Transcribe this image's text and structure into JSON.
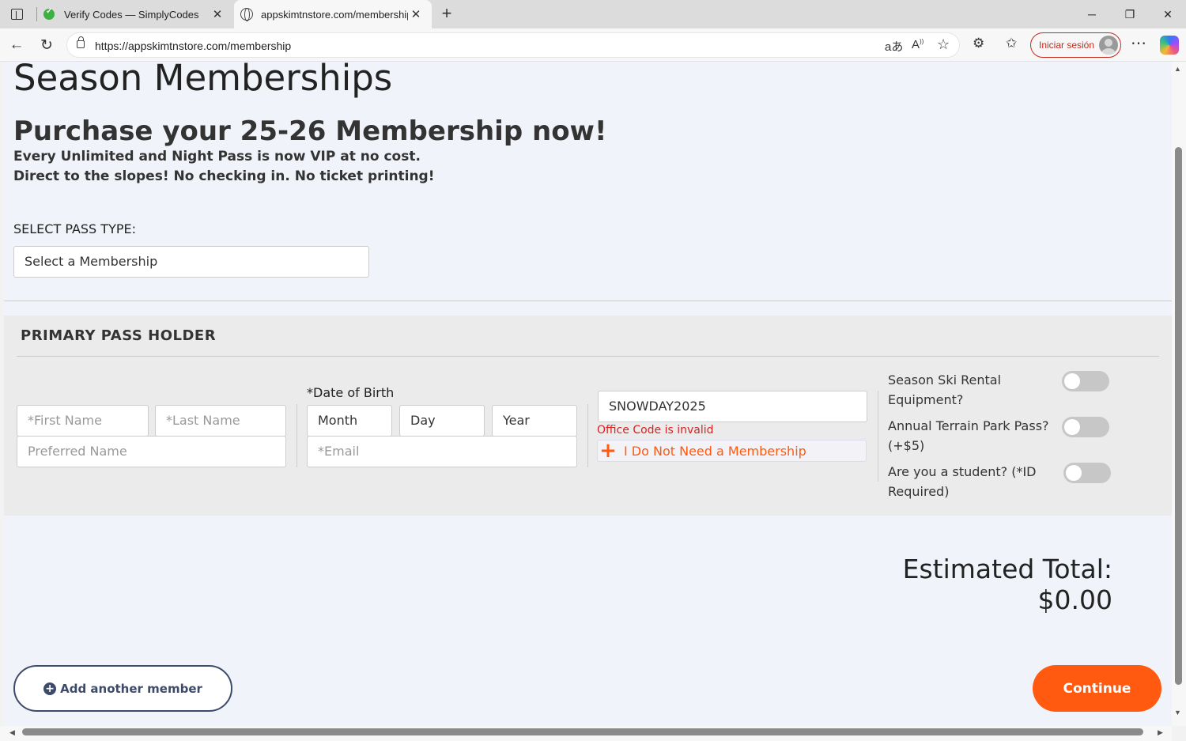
{
  "browser": {
    "tabs": [
      {
        "title": "Verify Codes — SimplyCodes",
        "icon": "simplycodes-favicon"
      },
      {
        "title": "appskimtnstore.com/membership",
        "icon": "globe-icon"
      }
    ],
    "url": "https://appskimtnstore.com/membership",
    "signin_label": "Iniciar sesión",
    "icons": {
      "read_aloud": "Aͅ",
      "translate": "aあ"
    }
  },
  "page": {
    "title": "Season Memberships",
    "promo_heading": "Purchase your 25-26 Membership now!",
    "promo_line1": "Every Unlimited and Night Pass is now VIP at no cost.",
    "promo_line2": "Direct to the slopes! No checking in. No ticket printing!",
    "select_label": "SELECT PASS TYPE:",
    "select_value": "Select a Membership"
  },
  "holder": {
    "title": "PRIMARY PASS HOLDER",
    "first_name_ph": "*First Name",
    "last_name_ph": "*Last Name",
    "preferred_name_ph": "Preferred Name",
    "dob_label": "*Date of Birth",
    "month": "Month",
    "day": "Day",
    "year": "Year",
    "email_ph": "*Email",
    "office_code_value": "SNOWDAY2025",
    "office_code_error": "Office Code is invalid",
    "no_membership_label": "I Do Not Need a Membership",
    "options": [
      {
        "label": "Season Ski Rental Equipment?",
        "on": false
      },
      {
        "label": "Annual Terrain Park Pass? (+$5)",
        "on": false
      },
      {
        "label": "Are you a student? (*ID Required)",
        "on": false
      }
    ]
  },
  "summary": {
    "total_label": "Estimated Total:",
    "total_value": "$0.00"
  },
  "actions": {
    "add_member_label": "Add another member",
    "continue_label": "Continue"
  },
  "colors": {
    "accent": "#ff5a0f",
    "navy": "#3d4b6b",
    "error": "#d82020"
  }
}
